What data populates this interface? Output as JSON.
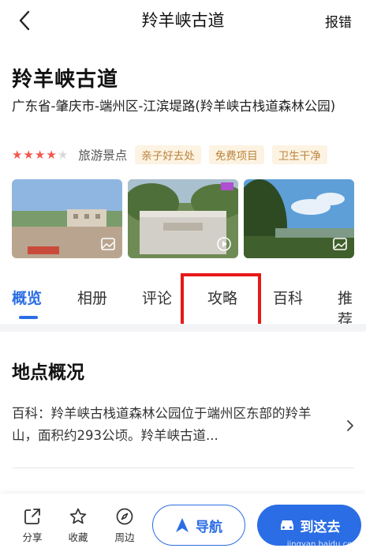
{
  "topbar": {
    "title": "羚羊峡古道",
    "report_label": "报错"
  },
  "place": {
    "name": "羚羊峡古道",
    "address": "广东省-肇庆市-端州区-江滨堤路(羚羊峡古栈道森林公园)",
    "rating_stars": 4,
    "rating_max": 5,
    "category": "旅游景点",
    "tags": [
      "亲子好去处",
      "免费项目",
      "卫生干净"
    ]
  },
  "photos": [
    {
      "icon": "image-icon"
    },
    {
      "icon": "play-icon"
    },
    {
      "icon": "image-icon"
    }
  ],
  "tabs": [
    "概览",
    "相册",
    "评论",
    "攻略",
    "百科",
    "推荐"
  ],
  "active_tab": "概览",
  "overview": {
    "title": "地点概况",
    "summary": "百科：羚羊峡古栈道森林公园位于端州区东部的羚羊山，面积约293公顷。羚羊峡古道..."
  },
  "bottom": {
    "share": "分享",
    "favorite": "收藏",
    "nearby": "周边",
    "navigate": "导航",
    "go": "到这去"
  },
  "watermark": "jingyan.baidu.com",
  "colors": {
    "accent": "#2b6de4",
    "star": "#f2574b",
    "tag_bg": "#fdf3e3",
    "tag_text": "#b9843d",
    "highlight": "#e81818"
  }
}
